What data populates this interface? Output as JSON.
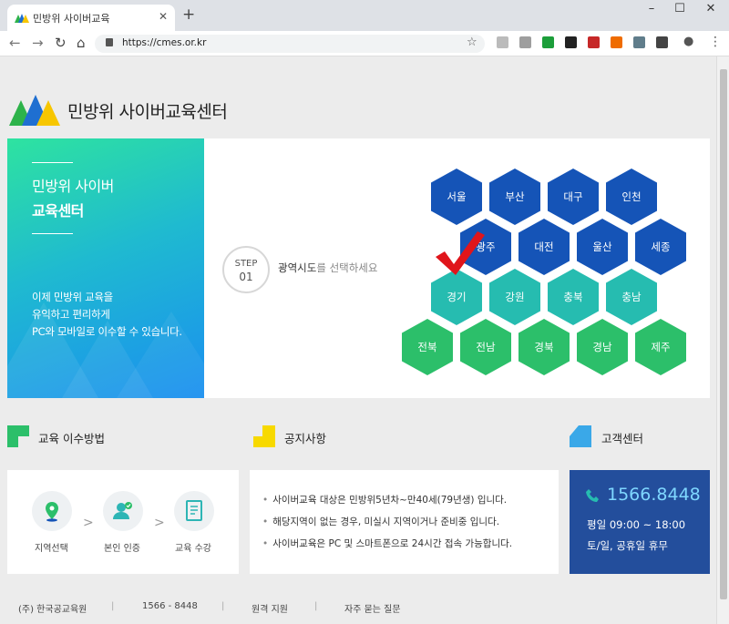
{
  "browser": {
    "tab_title": "민방위 사이버교육",
    "tab_close": "✕",
    "new_tab": "+",
    "url": "https://cmes.or.kr",
    "window_controls": [
      "–",
      "☐",
      "✕"
    ],
    "nav": [
      "←",
      "→",
      "↻",
      "⌂"
    ],
    "bookmark_icon": "☆",
    "extensions": [
      {
        "name": "cursor-ext-icon",
        "color": "#bbbbbb"
      },
      {
        "name": "mail-ext-icon",
        "color": "#9e9e9e"
      },
      {
        "name": "on-ext-icon",
        "color": "#1c9e3a"
      },
      {
        "name": "a-ext-icon",
        "color": "#222222"
      },
      {
        "name": "play-ext-icon",
        "color": "#c62828"
      },
      {
        "name": "ex-ext-icon",
        "color": "#ef6c00"
      },
      {
        "name": "download-ext-icon",
        "color": "#607d8b"
      },
      {
        "name": "info-ext-icon",
        "color": "#444444"
      }
    ],
    "account_icon": "●",
    "menu_icon": "⋮"
  },
  "site": {
    "title": "민방위 사이버교육센터",
    "logo_colors": [
      "#2db34a",
      "#1f6fd1",
      "#f7c600"
    ]
  },
  "banner": {
    "line1": "민방위 사이버",
    "line2": "교육센터",
    "desc": [
      "이제 민방위 교육을",
      "유익하고 편리하게",
      "PC와 모바일로 이수할 수 있습니다."
    ]
  },
  "step": {
    "label": "STEP",
    "number": "01",
    "strong": "광역시도",
    "rest": "를 선택하세요"
  },
  "regions": {
    "row1": [
      "서울",
      "부산",
      "대구",
      "인천"
    ],
    "row2": [
      "광주",
      "대전",
      "울산",
      "세종"
    ],
    "row3": [
      "경기",
      "강원",
      "충북",
      "충남"
    ],
    "row4": [
      "전북",
      "전남",
      "경북",
      "경남",
      "제주"
    ],
    "selected": "경기",
    "colors": {
      "blue": "#1554b7",
      "teal": "#26bcb0",
      "green": "#2cbf6a",
      "check": "#e0151b"
    }
  },
  "howto": {
    "title": "교육 이수방법",
    "steps": [
      "지역선택",
      "본인 인증",
      "교육 수강"
    ],
    "arrow": ">"
  },
  "notice": {
    "title": "공지사항",
    "items": [
      "사이버교육 대상은 민방위5년차~만40세(79년생) 입니다.",
      "해당지역이 없는 경우, 미실시 지역이거나 준비중 입니다.",
      "사이버교육은 PC 및 스마트폰으로 24시간 접속 가능합니다."
    ]
  },
  "support": {
    "title": "고객센터",
    "phone": "1566.8448",
    "weekday": "평일 09:00 ~ 18:00",
    "weekend": "토/일, 공휴일 휴무"
  },
  "footer": {
    "items": [
      "(주) 한국공교육원",
      "1566 - 8448",
      "원격 지원",
      "자주 묻는 질문"
    ],
    "separator": "|"
  }
}
